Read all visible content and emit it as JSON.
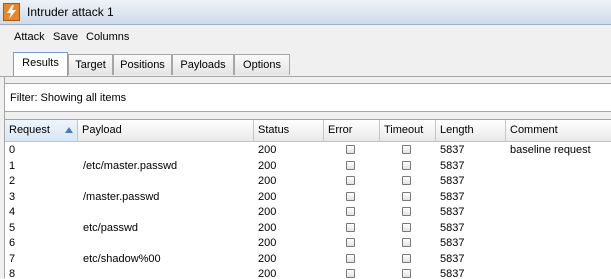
{
  "window": {
    "title": "Intruder attack 1"
  },
  "menu": [
    "Attack",
    "Save",
    "Columns"
  ],
  "tabs": [
    {
      "label": "Results",
      "active": true
    },
    {
      "label": "Target",
      "active": false
    },
    {
      "label": "Positions",
      "active": false
    },
    {
      "label": "Payloads",
      "active": false
    },
    {
      "label": "Options",
      "active": false
    }
  ],
  "filter": {
    "text": "Filter:  Showing all items"
  },
  "table": {
    "columns": [
      "Request",
      "Payload",
      "Status",
      "Error",
      "Timeout",
      "Length",
      "Comment"
    ],
    "sorted_column": "Request",
    "rows": [
      {
        "request": "0",
        "payload": "",
        "status": "200",
        "error": false,
        "timeout": false,
        "length": "5837",
        "comment": "baseline request"
      },
      {
        "request": "1",
        "payload": "/etc/master.passwd",
        "status": "200",
        "error": false,
        "timeout": false,
        "length": "5837",
        "comment": ""
      },
      {
        "request": "2",
        "payload": "",
        "status": "200",
        "error": false,
        "timeout": false,
        "length": "5837",
        "comment": ""
      },
      {
        "request": "3",
        "payload": "/master.passwd",
        "status": "200",
        "error": false,
        "timeout": false,
        "length": "5837",
        "comment": ""
      },
      {
        "request": "4",
        "payload": "",
        "status": "200",
        "error": false,
        "timeout": false,
        "length": "5837",
        "comment": ""
      },
      {
        "request": "5",
        "payload": "etc/passwd",
        "status": "200",
        "error": false,
        "timeout": false,
        "length": "5837",
        "comment": ""
      },
      {
        "request": "6",
        "payload": "",
        "status": "200",
        "error": false,
        "timeout": false,
        "length": "5837",
        "comment": ""
      },
      {
        "request": "7",
        "payload": "etc/shadow%00",
        "status": "200",
        "error": false,
        "timeout": false,
        "length": "5837",
        "comment": ""
      },
      {
        "request": "8",
        "payload": "",
        "status": "200",
        "error": false,
        "timeout": false,
        "length": "5837",
        "comment": ""
      }
    ]
  }
}
